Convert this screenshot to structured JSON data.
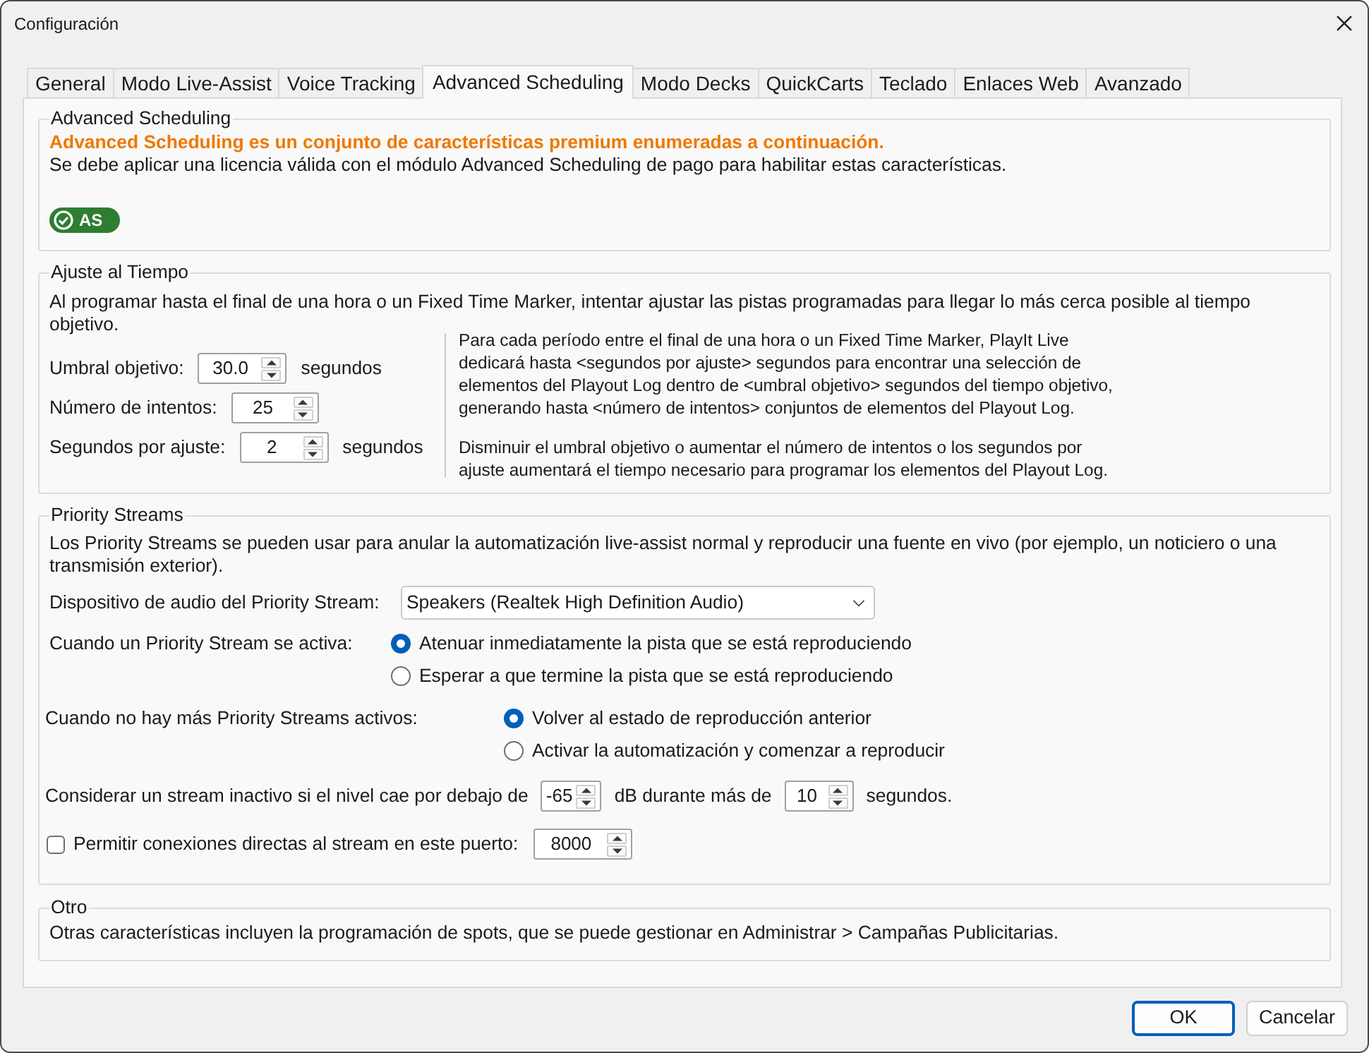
{
  "window": {
    "title": "Configuración"
  },
  "tabs": [
    {
      "label": "General",
      "selected": false
    },
    {
      "label": "Modo Live-Assist",
      "selected": false
    },
    {
      "label": "Voice Tracking",
      "selected": false
    },
    {
      "label": "Advanced Scheduling",
      "selected": true
    },
    {
      "label": "Modo Decks",
      "selected": false
    },
    {
      "label": "QuickCarts",
      "selected": false
    },
    {
      "label": "Teclado",
      "selected": false
    },
    {
      "label": "Enlaces Web",
      "selected": false
    },
    {
      "label": "Avanzado",
      "selected": false
    }
  ],
  "advanced_scheduling": {
    "title": "Advanced Scheduling",
    "notice": "Advanced Scheduling es un conjunto de características premium enumeradas a continuación.",
    "description": "Se debe aplicar una licencia válida con el módulo Advanced Scheduling de pago para habilitar estas características.",
    "badge": "AS"
  },
  "time_fit": {
    "title": "Ajuste al Tiempo",
    "description": "Al programar hasta el final de una hora o un Fixed Time Marker, intentar ajustar las pistas programadas para llegar lo más cerca posible al tiempo objetivo.",
    "fields": [
      {
        "label": "Umbral objetivo:",
        "value": "30.0",
        "unit": "segundos"
      },
      {
        "label": "Número de intentos:",
        "value": "25"
      },
      {
        "label": "Segundos por ajuste:",
        "value": "2",
        "unit": "segundos"
      }
    ],
    "help": [
      "Para cada período entre el final de una hora o un Fixed Time Marker, PlayIt Live dedicará hasta <segundos por ajuste> segundos para encontrar una selección de elementos del Playout Log dentro de <umbral objetivo> segundos del tiempo objetivo, generando hasta <número de intentos> conjuntos de elementos del Playout Log.",
      "Disminuir el umbral objetivo o aumentar el número de intentos o los segundos por ajuste aumentará el tiempo necesario para programar los elementos del Playout Log."
    ]
  },
  "priority_streams": {
    "title": "Priority Streams",
    "description": "Los Priority Streams se pueden usar para anular la automatización live-assist normal y reproducir una fuente en vivo (por ejemplo, un noticiero o una transmisión exterior).",
    "device": {
      "label": "Dispositivo de audio del Priority Stream:",
      "value": "Speakers (Realtek High Definition Audio)"
    },
    "radio_groups": [
      {
        "label": "Cuando un Priority Stream se activa:",
        "options": [
          {
            "label": "Atenuar inmediatamente la pista que se está reproduciendo",
            "selected": true
          },
          {
            "label": "Esperar a que termine la pista que se está reproduciendo",
            "selected": false
          }
        ]
      },
      {
        "label": "Cuando no hay más Priority Streams activos:",
        "options": [
          {
            "label": "Volver al estado de reproducción anterior",
            "selected": true
          },
          {
            "label": "Activar la automatización y comenzar a reproducir",
            "selected": false
          }
        ]
      }
    ],
    "inactivity": {
      "label_before": "Considerar un stream inactivo si el nivel cae por debajo de",
      "level_value": "-65",
      "label_middle": "dB durante más de",
      "seconds_value": "10",
      "label_after": "segundos."
    },
    "direct_connection": {
      "label": "Permitir conexiones directas al stream en este puerto:",
      "checked": false,
      "port": "8000"
    }
  },
  "other": {
    "title": "Otro",
    "description": "Otras características incluyen la programación de spots, que se puede gestionar en Administrar > Campañas Publicitarias."
  },
  "buttons": [
    {
      "label": "OK",
      "default": true
    },
    {
      "label": "Cancelar",
      "default": false
    }
  ]
}
